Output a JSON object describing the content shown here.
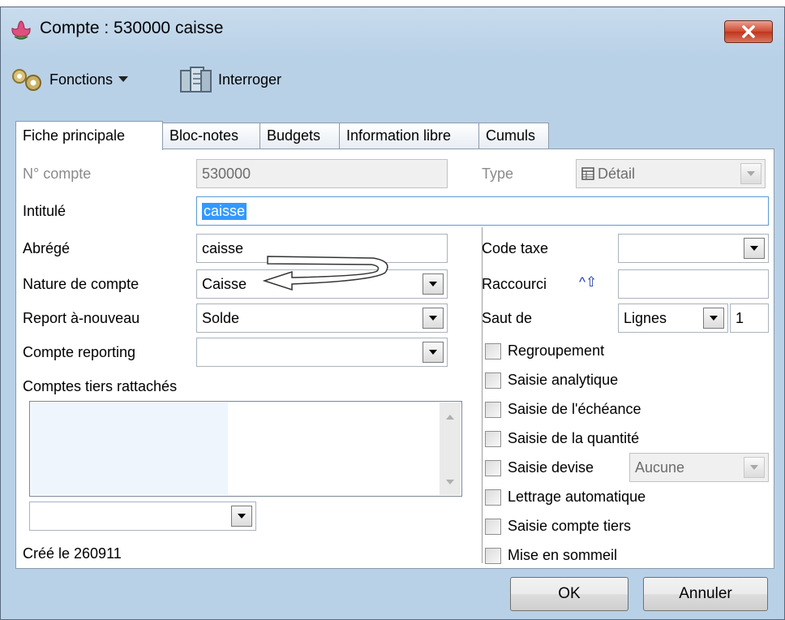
{
  "window": {
    "title": "Compte : 530000 caisse"
  },
  "toolbar": {
    "fonctions_label": "Fonctions",
    "interroger_label": "Interroger"
  },
  "tabs": [
    "Fiche principale",
    "Bloc-notes",
    "Budgets",
    "Information libre",
    "Cumuls"
  ],
  "form": {
    "numero": {
      "label": "N° compte",
      "value": "530000"
    },
    "type": {
      "label": "Type",
      "value": "Détail"
    },
    "intitule": {
      "label": "Intitulé",
      "value": "caisse"
    },
    "abrege": {
      "label": "Abrégé",
      "value": "caisse"
    },
    "nature": {
      "label": "Nature de compte",
      "value": "Caisse"
    },
    "report": {
      "label": "Report à-nouveau",
      "value": "Solde"
    },
    "reporting": {
      "label": "Compte reporting",
      "value": ""
    },
    "tiers": {
      "label": "Comptes tiers rattachés"
    },
    "created": "Créé le 260911",
    "code_taxe": {
      "label": "Code taxe",
      "value": ""
    },
    "raccourci": {
      "label": "Raccourci",
      "symbol": "^⇧",
      "value": ""
    },
    "saut": {
      "label": "Saut de",
      "unit": "Lignes",
      "value": "1"
    }
  },
  "checkboxes": [
    "Regroupement",
    "Saisie analytique",
    "Saisie de l'échéance",
    "Saisie de la quantité",
    "Saisie devise",
    "Lettrage automatique",
    "Saisie compte tiers",
    "Mise en sommeil"
  ],
  "devise": {
    "value": "Aucune"
  },
  "buttons": {
    "ok": "OK",
    "cancel": "Annuler"
  }
}
